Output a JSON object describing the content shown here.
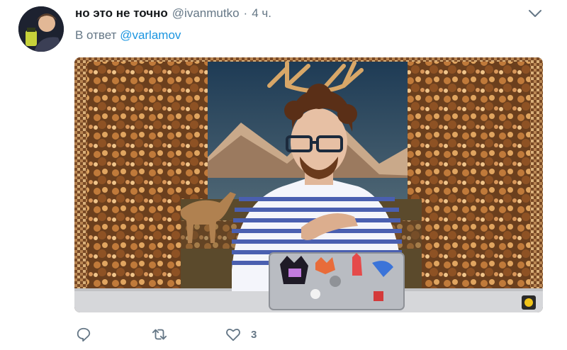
{
  "tweet": {
    "display_name": "но это не точно",
    "handle": "@ivanmutko",
    "separator": "·",
    "time": "4 ч.",
    "reply_prefix": "В ответ",
    "reply_mention": "@varlamov",
    "media_icon": "video-photo",
    "channel_badge_icon": "channel-logo-icon"
  },
  "actions": {
    "reply_icon": "reply-icon",
    "retweet_icon": "retweet-icon",
    "like_icon": "like-icon",
    "like_count": "3"
  },
  "colors": {
    "link": "#1b95e0",
    "muted": "#657786",
    "text": "#14171a"
  }
}
